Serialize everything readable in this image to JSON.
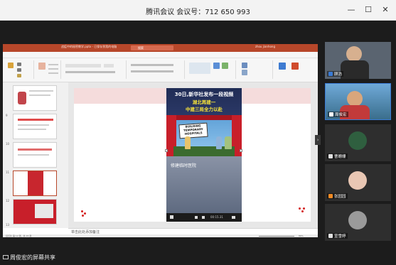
{
  "window": {
    "title": "腾讯会议  会议号：712 650 993",
    "minimize": "—",
    "maximize": "☐",
    "close": "✕"
  },
  "ppt": {
    "filename": "战疫中的秘密教学.pptx - 已保存到我的电脑",
    "search_label": "搜索",
    "user": "zhou jianhong",
    "tabs": [
      "文件",
      "开始",
      "插入",
      "设计",
      "切换",
      "动画",
      "幻灯片放映",
      "审阅",
      "视图",
      "PDF工具集",
      "帮助",
      "ACROBAT",
      "绘图工具",
      "视频格式"
    ],
    "thumb_numbers": [
      "9",
      "10",
      "11",
      "12",
      "13"
    ],
    "notes_placeholder": "单击此处添加备注",
    "status_left": "幻灯片 第 12 张，共 15 张",
    "zoom": "86%",
    "slide": {
      "heading_line1": "30日,新华社发布一段视频",
      "heading_line2": "湖北再建一",
      "heading_line3": "中建三局全力以赴",
      "sign_line1": "BUILDING",
      "sign_line2": "TEMPORARY",
      "sign_line3": "HOSPITALS",
      "video_caption": "修建临时医院",
      "video_time": "00:15.31"
    }
  },
  "participants": [
    {
      "name": "顾浩"
    },
    {
      "name": "周俊宏"
    },
    {
      "name": "曹姗姗"
    },
    {
      "name": "张园园"
    },
    {
      "name": "宣雪婷"
    }
  ],
  "share_label": "周俊宏的屏幕共享",
  "colors": {
    "ppt_brand": "#b7472a",
    "panel_bg": "#1c1c1c",
    "active_border": "#3a7bd5"
  }
}
